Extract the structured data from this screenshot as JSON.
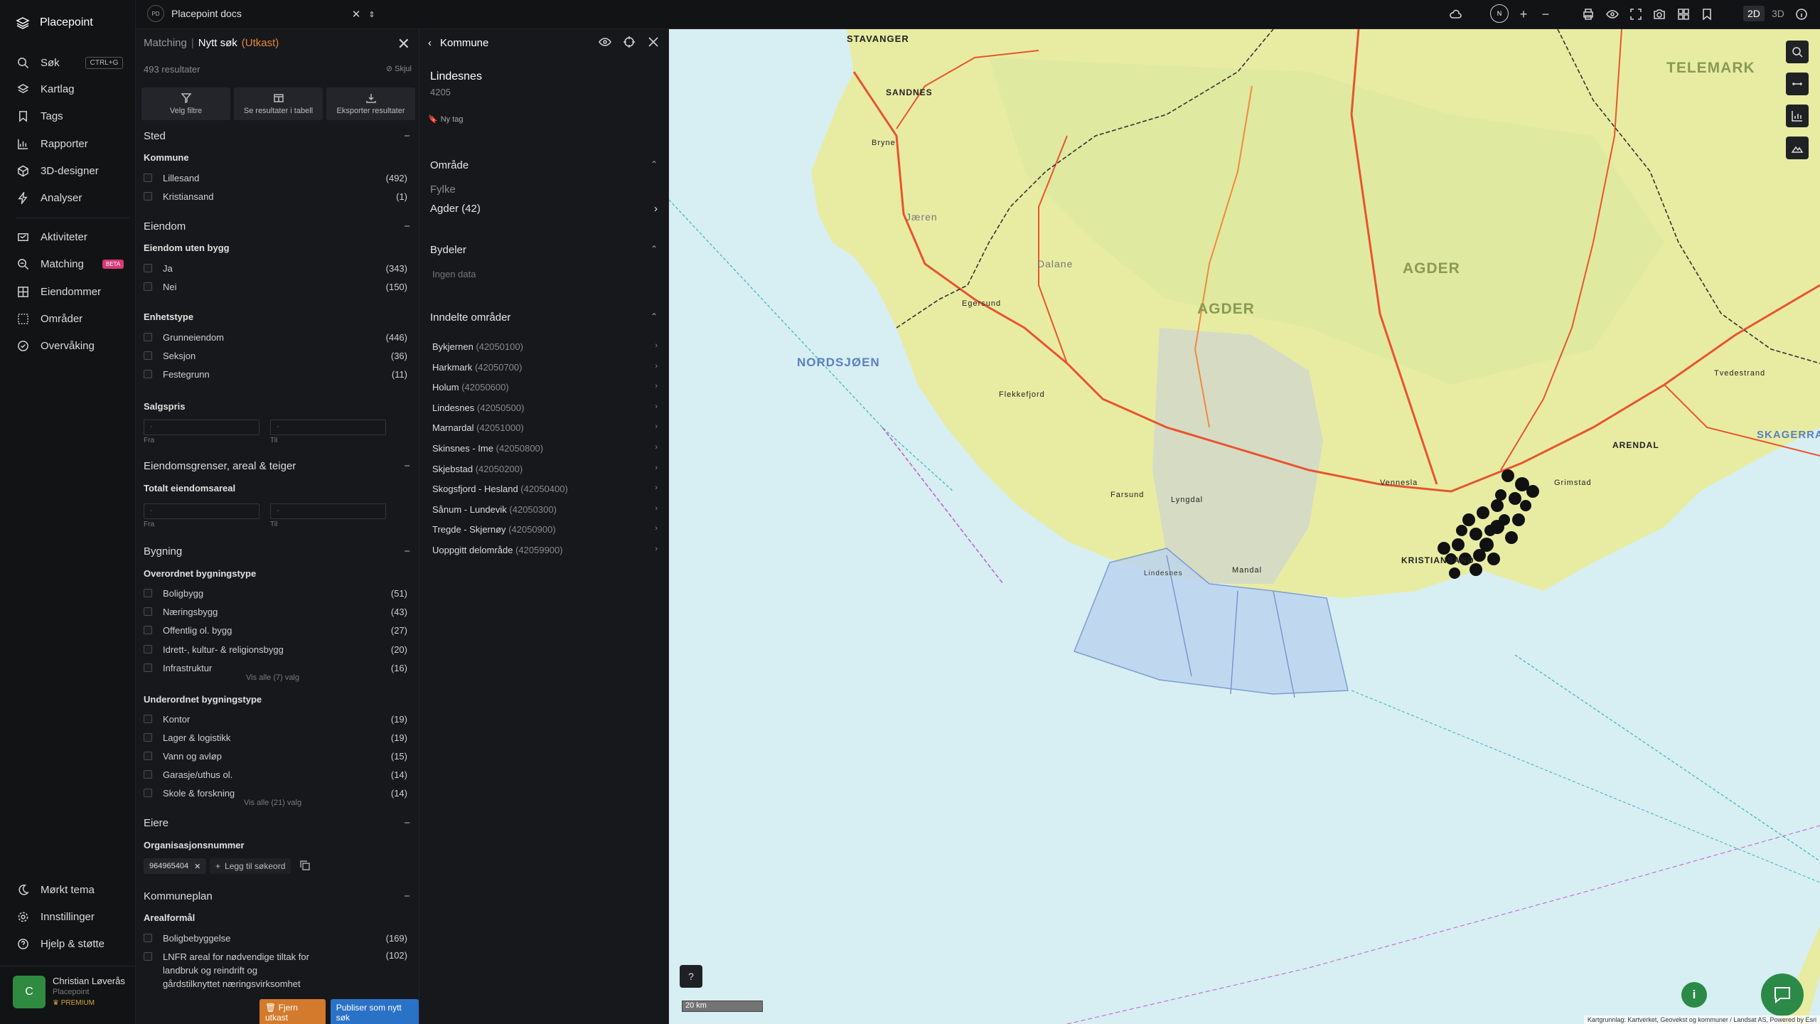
{
  "app": {
    "name": "Placepoint"
  },
  "nav": {
    "items": [
      {
        "label": "Søk",
        "shortcut": "CTRL+G"
      },
      {
        "label": "Kartlag"
      },
      {
        "label": "Tags"
      },
      {
        "label": "Rapporter"
      },
      {
        "label": "3D-designer"
      },
      {
        "label": "Analyser"
      },
      {
        "label": "Aktiviteter"
      },
      {
        "label": "Matching",
        "badge": "BETA"
      },
      {
        "label": "Eiendommer"
      },
      {
        "label": "Områder"
      },
      {
        "label": "Overvåking"
      }
    ],
    "bottom": [
      {
        "label": "Mørkt tema"
      },
      {
        "label": "Innstillinger"
      },
      {
        "label": "Hjelp & støtte"
      }
    ],
    "user": {
      "initial": "C",
      "name": "Christian Løverås",
      "org": "Placepoint",
      "plan": "PREMIUM"
    }
  },
  "topbar": {
    "doc_badge": "PD",
    "doc_name": "Placepoint docs",
    "compass": "N",
    "mode_2d": "2D",
    "mode_3d": "3D",
    "active_mode": "2D"
  },
  "filter": {
    "crumb_parent": "Matching",
    "crumb_current": "Nytt søk",
    "crumb_status": "(Utkast)",
    "result_count": "493 resultater",
    "hide_label": "Skjul",
    "actions": [
      "Velg filtre",
      "Se resultater i tabell",
      "Eksporter resultater"
    ],
    "sections": {
      "sted": "Sted",
      "eiendom": "Eiendom",
      "grenser": "Eiendomsgrenser, areal & teiger",
      "bygning": "Bygning",
      "eiere": "Eiere",
      "kommuneplan": "Kommuneplan"
    },
    "kommune_label": "Kommune",
    "kommune": [
      {
        "label": "Lillesand",
        "count": "(492)"
      },
      {
        "label": "Kristiansand",
        "count": "(1)"
      }
    ],
    "uten_bygg_label": "Eiendom uten bygg",
    "uten_bygg": [
      {
        "label": "Ja",
        "count": "(343)"
      },
      {
        "label": "Nei",
        "count": "(150)"
      }
    ],
    "enhetstype_label": "Enhetstype",
    "enhetstype": [
      {
        "label": "Grunneiendom",
        "count": "(446)"
      },
      {
        "label": "Seksjon",
        "count": "(36)"
      },
      {
        "label": "Festegrunn",
        "count": "(11)"
      }
    ],
    "salgspris_label": "Salgspris",
    "range_placeholder": "-",
    "from_label": "Fra",
    "to_label": "Til",
    "totalt_areal_label": "Totalt eiendomsareal",
    "overordnet_label": "Overordnet bygningstype",
    "overordnet": [
      {
        "label": "Boligbygg",
        "count": "(51)"
      },
      {
        "label": "Næringsbygg",
        "count": "(43)"
      },
      {
        "label": "Offentlig ol. bygg",
        "count": "(27)"
      },
      {
        "label": "Idrett-, kultur- & religionsbygg",
        "count": "(20)"
      },
      {
        "label": "Infrastruktur",
        "count": "(16)"
      }
    ],
    "overordnet_more": "Vis alle (7) valg",
    "underordnet_label": "Underordnet bygningstype",
    "underordnet": [
      {
        "label": "Kontor",
        "count": "(19)"
      },
      {
        "label": "Lager & logistikk",
        "count": "(19)"
      },
      {
        "label": "Vann og avløp",
        "count": "(15)"
      },
      {
        "label": "Garasje/uthus ol.",
        "count": "(14)"
      },
      {
        "label": "Skole & forskning",
        "count": "(14)"
      }
    ],
    "underordnet_more": "Vis alle (21) valg",
    "orgnr_label": "Organisasjonsnummer",
    "orgnr_tag": "964965404",
    "add_keyword": "Legg til søkeord",
    "arealformal_label": "Arealformål",
    "arealformal": [
      {
        "label": "Boligbebyggelse",
        "count": "(169)"
      },
      {
        "label": "LNFR areal for nødvendige tiltak for landbruk og reindrift og gårdstilknyttet næringsvirksomhet basert på gårdens ressursgrunnlag",
        "count": "(102)"
      }
    ],
    "btn_remove": "Fjern utkast",
    "btn_publish": "Publiser som nytt søk"
  },
  "kommune_panel": {
    "title": "Kommune",
    "name": "Lindesnes",
    "code": "4205",
    "new_tag": "Ny tag",
    "omrade_label": "Område",
    "fylke_label": "Fylke",
    "fylke_value": "Agder (42)",
    "bydeler_label": "Bydeler",
    "bydeler_empty": "Ingen data",
    "inndelte_label": "Inndelte områder",
    "inndelte": [
      {
        "name": "Bykjernen",
        "code": "(42050100)"
      },
      {
        "name": "Harkmark",
        "code": "(42050700)"
      },
      {
        "name": "Holum",
        "code": "(42050600)"
      },
      {
        "name": "Lindesnes",
        "code": "(42050500)"
      },
      {
        "name": "Marnardal",
        "code": "(42051000)"
      },
      {
        "name": "Skinsnes - Ime",
        "code": "(42050800)"
      },
      {
        "name": "Skjebstad",
        "code": "(42050200)"
      },
      {
        "name": "Skogsfjord - Hesland",
        "code": "(42050400)"
      },
      {
        "name": "Sånum - Lundevik",
        "code": "(42050300)"
      },
      {
        "name": "Tregde - Skjernøy",
        "code": "(42050900)"
      },
      {
        "name": "Uoppgitt delområde",
        "code": "(42059900)"
      }
    ]
  },
  "map": {
    "labels": {
      "agder_big": "AGDER",
      "agder_west": "AGDER",
      "telemark": "TELEMARK",
      "nordsjoen": "NORDSJØEN",
      "skagerrak": "SKAGERRAK",
      "stavanger": "STAVANGER",
      "sandnes": "SANDNES",
      "kristiansand": "KRISTIANSAND",
      "arendal": "ARENDAL",
      "grimstad": "Grimstad",
      "mandal": "Mandal",
      "lindesnes": "Lindesnes",
      "flekkefjord": "Flekkefjord",
      "egersund": "Egersund",
      "vennesla": "Vennesla",
      "jaeren": "Jæren",
      "dalane": "Dalane",
      "bryne": "Bryne",
      "farsund": "Farsund",
      "lyngdal": "Lyngdal",
      "tvedestrand": "Tvedestrand"
    },
    "scale": "20 km",
    "help": "?",
    "info": "i",
    "attribution": "Kartgrunnlag: Kartverket, Geovekst og kommuner / Landsat AS, Powered by Esri",
    "colors": {
      "sea": "#d7eef3",
      "land": "#e9eda3",
      "roads": "#e8542f",
      "cluster": "#111111",
      "area": "#bcd4f0"
    }
  }
}
